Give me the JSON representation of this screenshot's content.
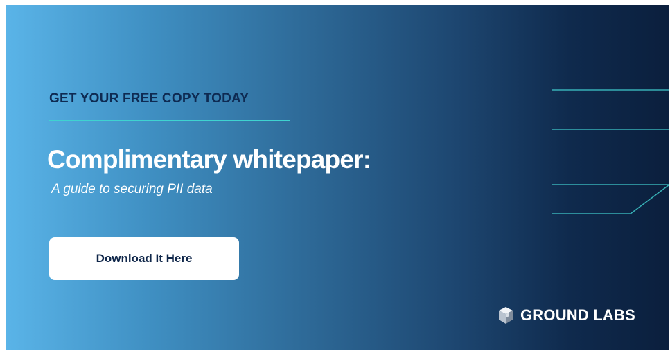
{
  "banner": {
    "eyebrow": "GET YOUR FREE COPY TODAY",
    "headline": "Complimentary whitepaper:",
    "subhead": "A guide to securing PII data",
    "cta_label": "Download It Here",
    "brand_name": "GROUND LABS",
    "brand_logo_icon": "ground-labs-logo-icon",
    "colors": {
      "gradient_start": "#5ab4e8",
      "gradient_end": "#0b1f3d",
      "eyebrow_text": "#0e2a52",
      "accent_line": "#3fd3d0",
      "cta_text": "#10274a"
    }
  }
}
